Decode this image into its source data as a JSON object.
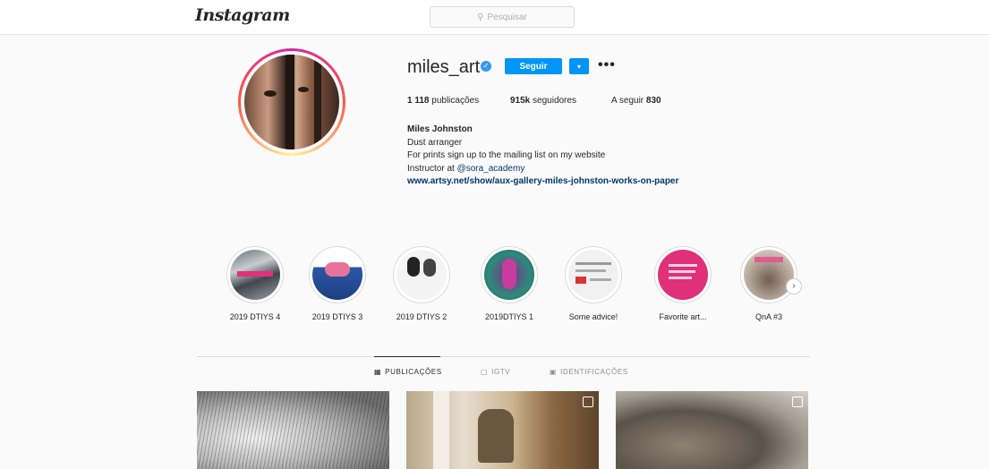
{
  "header": {
    "logo_text": "Instagram",
    "search_placeholder": "Pesquisar"
  },
  "profile": {
    "username": "miles_art",
    "follow_label": "Seguir",
    "dropdown_symbol": "▾",
    "more_symbol": "•••",
    "stats": {
      "posts_count": "1 118",
      "posts_label": "publicações",
      "followers_count": "915k",
      "followers_label": "seguidores",
      "following_label": "A seguir",
      "following_count": "830"
    },
    "bio": {
      "name": "Miles Johnston",
      "line1": "Dust arranger",
      "line2": "For prints sign up to the mailing list on my website",
      "line3_prefix": "Instructor at ",
      "line3_mention": "@sora_academy",
      "website": "www.artsy.net/show/aux-gallery-miles-johnston-works-on-paper"
    }
  },
  "highlights": [
    {
      "label": "2019 DTIYS 4"
    },
    {
      "label": "2019 DTIYS 3"
    },
    {
      "label": "2019 DTIYS 2"
    },
    {
      "label": "2019DTIYS 1"
    },
    {
      "label": "Some advice!"
    },
    {
      "label": "Favorite art..."
    },
    {
      "label": "QnA #3"
    }
  ],
  "tabs": [
    {
      "label": "PUBLICAÇÕES",
      "icon": "grid-icon",
      "active": true
    },
    {
      "label": "IGTV",
      "icon": "igtv-icon",
      "active": false
    },
    {
      "label": "IDENTIFICAÇÕES",
      "icon": "tag-icon",
      "active": false
    }
  ],
  "colors": {
    "accent_blue": "#0095f6",
    "verified_blue": "#3897f0",
    "link_blue": "#00376b"
  }
}
